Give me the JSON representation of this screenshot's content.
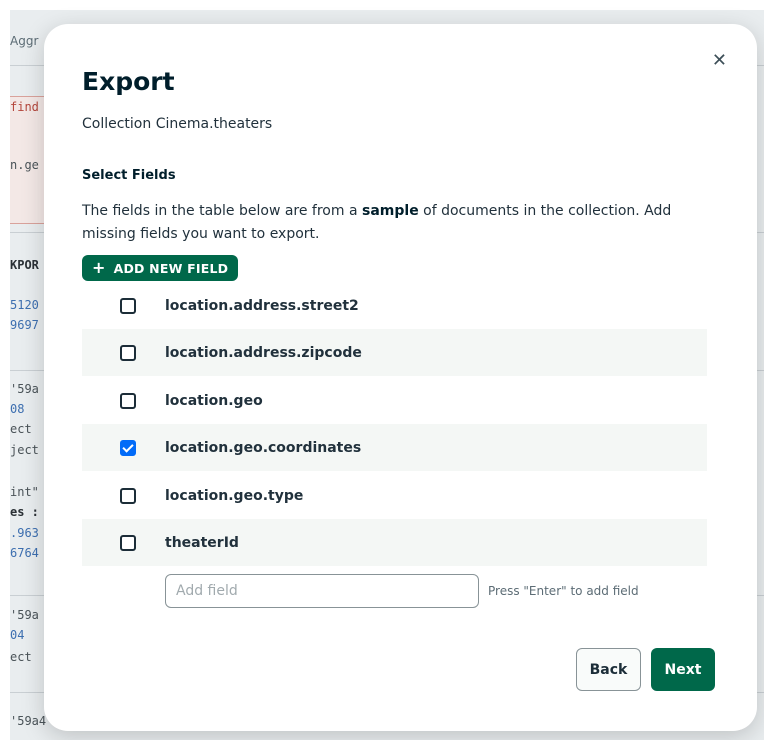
{
  "background": {
    "tab_partial": "Aggr",
    "code_lines": [
      {
        "text": "find",
        "style": "red"
      },
      {
        "text": "n.ge",
        "style": "plain"
      },
      {
        "text": "KPOR",
        "style": "bold"
      },
      {
        "text": "5120",
        "style": "blue"
      },
      {
        "text": "9697",
        "style": "blue"
      },
      {
        "text": "'59a",
        "style": "plain"
      },
      {
        "text": "08",
        "style": "blue"
      },
      {
        "text": "ect",
        "style": "plain"
      },
      {
        "text": "ject",
        "style": "plain"
      },
      {
        "text": "int\"",
        "style": "plain"
      },
      {
        "text": "es :",
        "style": "bold"
      },
      {
        "text": ".963",
        "style": "blue"
      },
      {
        "text": "6764",
        "style": "blue"
      },
      {
        "text": "'59a",
        "style": "plain"
      },
      {
        "text": "04",
        "style": "blue"
      },
      {
        "text": "ect",
        "style": "plain"
      },
      {
        "text": "'59a4",
        "style": "plain"
      }
    ]
  },
  "modal": {
    "title": "Export",
    "subtitle": "Collection Cinema.theaters",
    "close_icon": "close-icon",
    "select_fields_label": "Select Fields",
    "description_before": "The fields in the table below are from a ",
    "description_bold": "sample",
    "description_after": " of documents in the collection. Add missing fields you want to export.",
    "add_new_field_label": "ADD NEW FIELD",
    "fields": [
      {
        "name": "location.address.street2",
        "checked": false
      },
      {
        "name": "location.address.zipcode",
        "checked": false
      },
      {
        "name": "location.geo",
        "checked": false
      },
      {
        "name": "location.geo.coordinates",
        "checked": true
      },
      {
        "name": "location.geo.type",
        "checked": false
      },
      {
        "name": "theaterId",
        "checked": false
      }
    ],
    "add_field_input": {
      "value": "",
      "placeholder": "Add field"
    },
    "add_field_hint": "Press \"Enter\" to add field",
    "back_label": "Back",
    "next_label": "Next",
    "colors": {
      "primary": "#00684a",
      "checkbox_checked": "#016bf8"
    }
  }
}
